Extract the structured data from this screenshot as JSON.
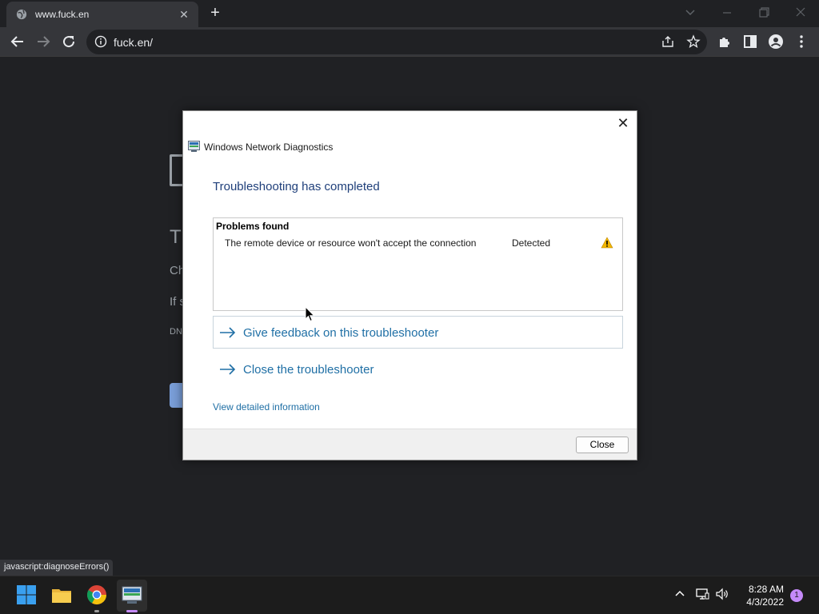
{
  "browser": {
    "tab_title": "www.fuck.en",
    "tab_close_glyph": "✕",
    "new_tab_glyph": "+",
    "address": "fuck.en/",
    "status_url": "javascript:diagnoseErrors()"
  },
  "error_page": {
    "heading_fragment": "Th",
    "line1_fragment": "Ch",
    "line2_fragment": "If s",
    "code_fragment": "DN"
  },
  "dialog": {
    "close_glyph": "✕",
    "app_title": "Windows Network Diagnostics",
    "heading": "Troubleshooting has completed",
    "problems_header": "Problems found",
    "problems": [
      {
        "description": "The remote device or resource won't accept the connection",
        "status": "Detected",
        "icon": "warning-icon"
      }
    ],
    "links": [
      {
        "label": "Give feedback on this troubleshooter"
      },
      {
        "label": "Close the troubleshooter"
      }
    ],
    "detail_link": "View detailed information",
    "close_button": "Close"
  },
  "taskbar": {
    "time": "8:28 AM",
    "date": "4/3/2022",
    "notification_count": "1"
  },
  "colors": {
    "accent_link": "#1f6fa5",
    "heading_blue": "#1f3f7a",
    "warning": "#f2b600"
  }
}
